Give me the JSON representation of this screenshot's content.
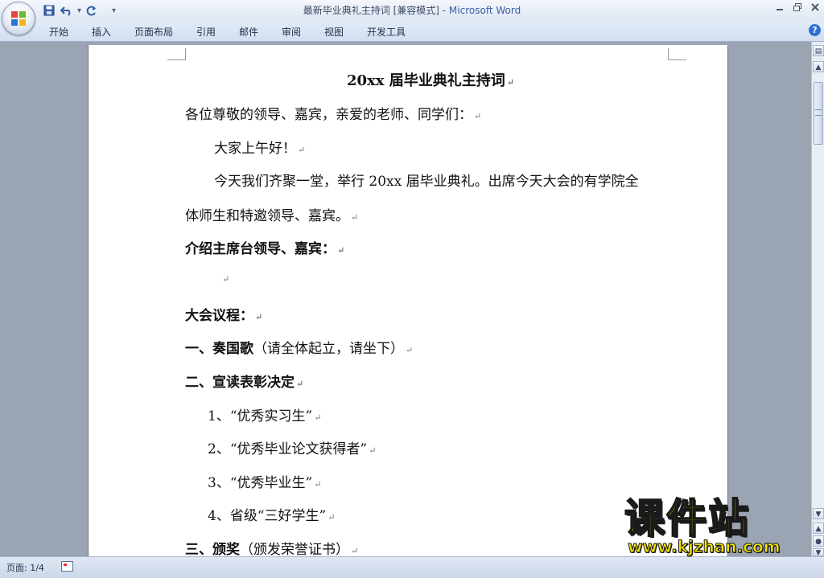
{
  "window": {
    "doc_title": "最新毕业典礼主持词 [兼容模式] - ",
    "app_name": "Microsoft Word"
  },
  "qat": {
    "customize_label": "▾"
  },
  "tabs": [
    "开始",
    "插入",
    "页面布局",
    "引用",
    "邮件",
    "审阅",
    "视图",
    "开发工具"
  ],
  "document": {
    "title": "20xx 届毕业典礼主持词",
    "lines": [
      {
        "text": "各位尊敬的领导、嘉宾，亲爱的老师、同学们：",
        "bold": false
      },
      {
        "text": "大家上午好！",
        "bold": false
      },
      {
        "text": "今天我们齐聚一堂，举行 20xx 届毕业典礼。出席今天大会的有学院全",
        "bold": false
      },
      {
        "text": "体师生和特邀领导、嘉宾。",
        "bold": false
      },
      {
        "text": "介绍主席台领导、嘉宾：",
        "bold": true
      },
      {
        "text": "",
        "bold": false
      },
      {
        "text": "大会议程：",
        "bold": true
      },
      {
        "text": "一、奏国歌",
        "bold": true,
        "suffix": "（请全体起立，请坐下）"
      },
      {
        "text": "二、宣读表彰决定",
        "bold": true
      },
      {
        "text": "1、“优秀实习生”",
        "bold": false
      },
      {
        "text": "2、“优秀毕业论文获得者”",
        "bold": false
      },
      {
        "text": "3、“优秀毕业生”",
        "bold": false
      },
      {
        "text": "4、省级“三好学生”",
        "bold": false
      },
      {
        "text": "三、颁奖",
        "bold": true,
        "suffix": "（颁发荣誉证书）"
      }
    ],
    "paragraph_mark": "↵"
  },
  "status": {
    "page": "页面: 1/4"
  },
  "watermark": {
    "big": "课件站",
    "url": "www.kjzhan.com"
  },
  "colors": {
    "accent": "#3b5fa8",
    "ribbon": "#d3def0",
    "watermark": "#f4e400"
  }
}
